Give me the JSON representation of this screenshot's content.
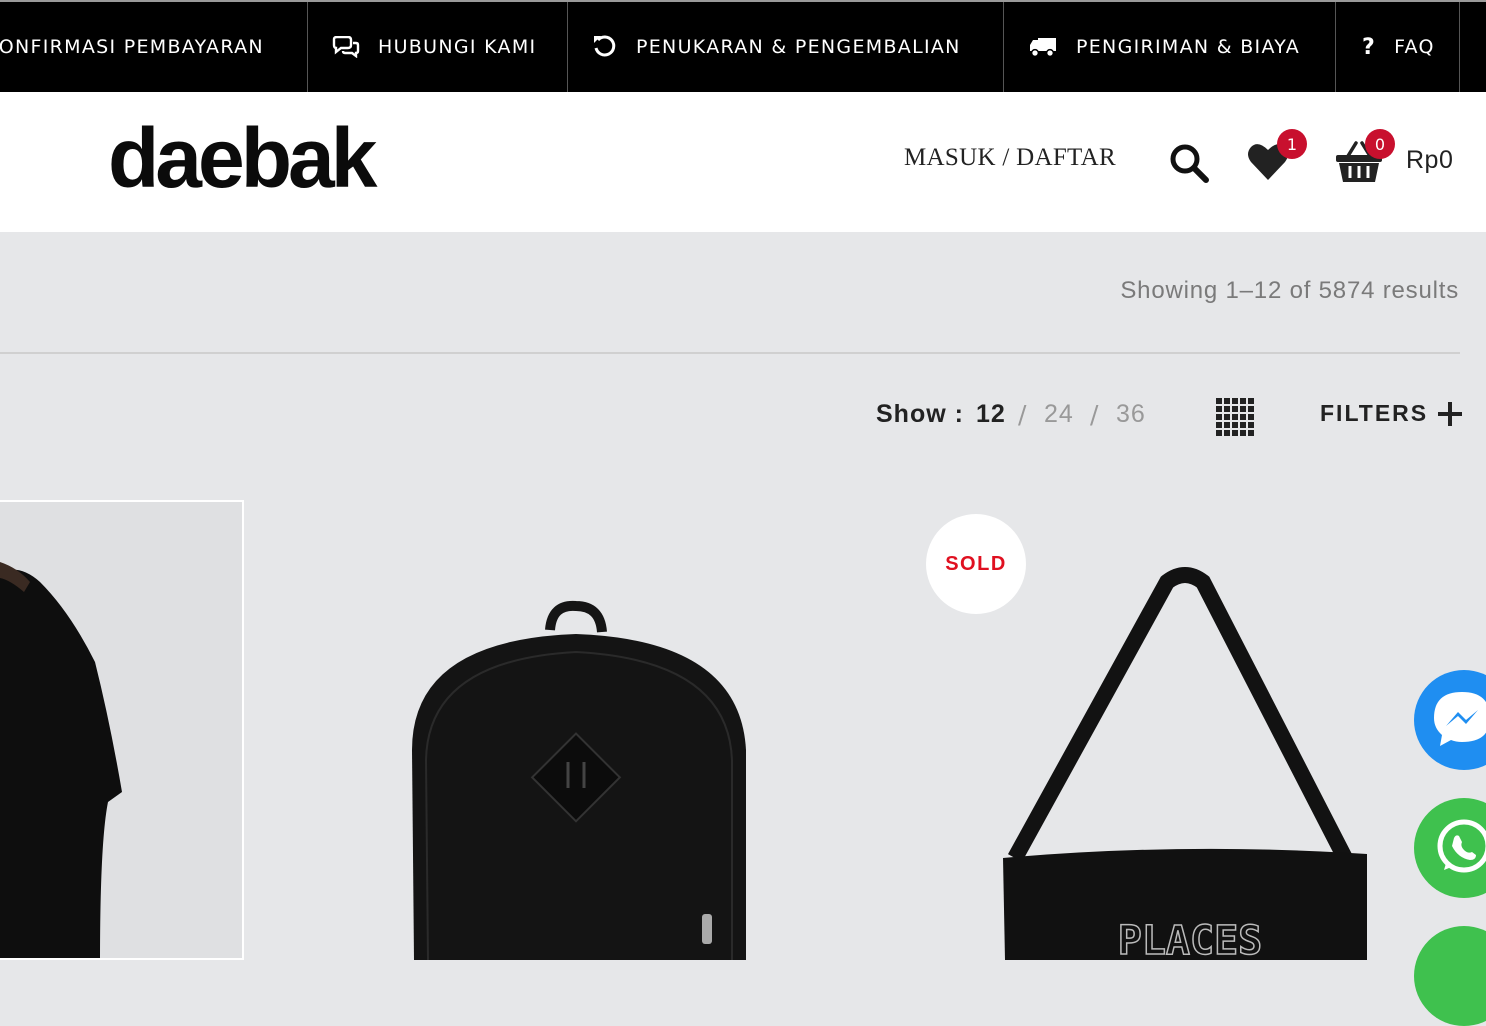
{
  "topbar": {
    "items": [
      {
        "label": "KONFIRMASI PEMBAYARAN",
        "icon": "credit-card-icon"
      },
      {
        "label": "HUBUNGI KAMI",
        "icon": "chat-bubbles-icon"
      },
      {
        "label": "PENUKARAN & PENGEMBALIAN",
        "icon": "undo-icon"
      },
      {
        "label": "PENGIRIMAN & BIAYA",
        "icon": "truck-icon"
      },
      {
        "label": "FAQ",
        "icon": "question-icon"
      }
    ]
  },
  "header": {
    "logo": "daebak",
    "login_label": "MASUK / DAFTAR",
    "wishlist_count": "1",
    "cart_count": "0",
    "cart_total": "Rp0"
  },
  "toolbar": {
    "results_text": "Showing 1–12 of 5874 results",
    "show_label": "Show :",
    "show_options": [
      "12",
      "24",
      "36"
    ],
    "show_selected": "12",
    "filters_label": "FILTERS"
  },
  "products": [
    {
      "image": "black t-shirt model"
    },
    {
      "image": "black backpack"
    },
    {
      "image": "black tote bag",
      "badge": "SOLD",
      "print_text": "PLACES"
    }
  ],
  "colors": {
    "accent": "#c8102e",
    "sold": "#e01020",
    "messenger": "#1f8ef1",
    "whatsapp": "#3fc14e"
  }
}
